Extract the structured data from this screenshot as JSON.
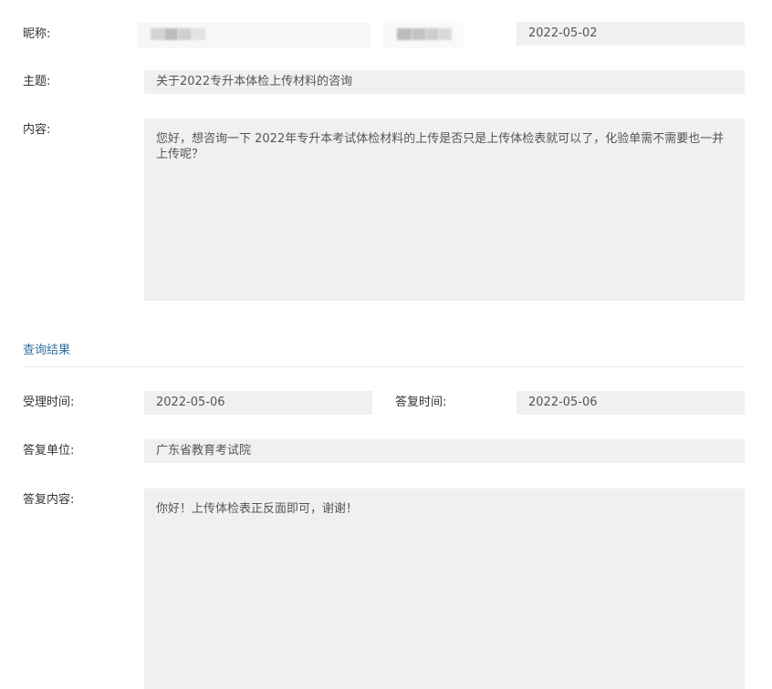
{
  "question": {
    "nickname_label": "昵称:",
    "date": "2022-05-02",
    "subject_label": "主题:",
    "subject_value": "关于2022专升本体检上传材料的咨询",
    "content_label": "内容:",
    "content_value": "您好，想咨询一下 2022年专升本考试体检材料的上传是否只是上传体检表就可以了，化验单需不需要也一并上传呢？"
  },
  "result": {
    "section_title": "查询结果",
    "accept_time_label": "受理时间:",
    "accept_time_value": "2022-05-06",
    "reply_time_label": "答复时间:",
    "reply_time_value": "2022-05-06",
    "reply_unit_label": "答复单位:",
    "reply_unit_value": "广东省教育考试院",
    "reply_content_label": "答复内容:",
    "reply_content_value": "你好！上传体检表正反面即可，谢谢！"
  }
}
